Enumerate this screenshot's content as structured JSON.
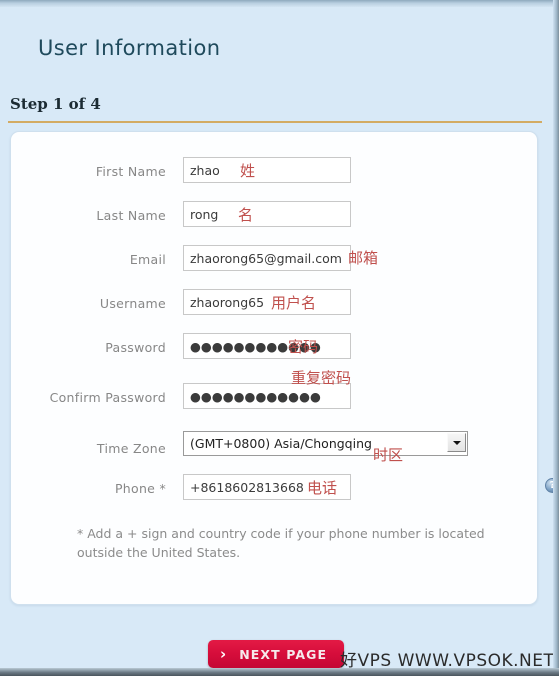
{
  "page": {
    "title": "User Information",
    "step": "Step 1 of 4"
  },
  "form": {
    "fields": [
      {
        "label": "First Name",
        "value": "zhao",
        "annotation": "姓",
        "type": "text"
      },
      {
        "label": "Last Name",
        "value": "rong",
        "annotation": "名",
        "type": "text"
      },
      {
        "label": "Email",
        "value": "zhaorong65@gmail.com",
        "annotation": "邮箱",
        "type": "text"
      },
      {
        "label": "Username",
        "value": "zhaorong65",
        "annotation": "用户名",
        "type": "text"
      },
      {
        "label": "Password",
        "value": "●●●●●●●●●●●●",
        "annotation": "密码",
        "type": "password"
      },
      {
        "label": "Confirm Password",
        "value": "●●●●●●●●●●●●",
        "annotation": "重复密码",
        "type": "password"
      },
      {
        "label": "Time Zone",
        "value": "(GMT+0800) Asia/Chongqing",
        "annotation": "时区",
        "type": "select"
      },
      {
        "label": "Phone *",
        "value": "+8618602813668",
        "annotation": "电话",
        "type": "text"
      }
    ],
    "help_icon_label": "?",
    "hint": "* Add a + sign and country code if your phone number is located outside the United States."
  },
  "footer": {
    "next_chevron": "›",
    "next_label": "NEXT PAGE",
    "watermark": "好VPS WWW.VPSOK.NET"
  },
  "colors": {
    "page_bg": "#d8e9f7",
    "title": "#1f4a5c",
    "rule": "#d3ab63",
    "annotation": "#c0504d",
    "button": "#d60d3b"
  }
}
